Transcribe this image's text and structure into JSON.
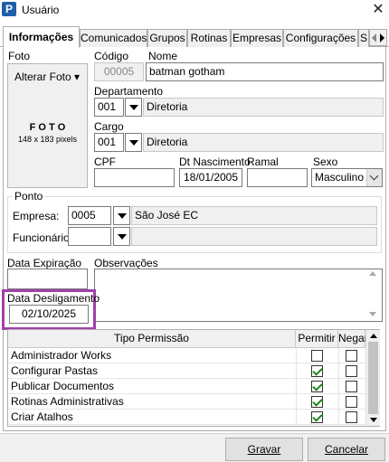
{
  "window": {
    "title": "Usuário",
    "app_icon": "P",
    "close": "✕"
  },
  "tabs": [
    {
      "label": "Informações"
    },
    {
      "label": "Comunicados"
    },
    {
      "label": "Grupos"
    },
    {
      "label": "Rotinas"
    },
    {
      "label": "Empresas"
    },
    {
      "label": "Configurações"
    },
    {
      "label": "S"
    }
  ],
  "foto": {
    "label": "Foto",
    "button": "Alterar Foto ▾",
    "placeholder_title": "F O T O",
    "placeholder_size": "148 x 183 pixels"
  },
  "codigo": {
    "label": "Código",
    "value": "00005"
  },
  "nome": {
    "label": "Nome",
    "value": "batman gotham"
  },
  "departamento": {
    "label": "Departamento",
    "code": "001",
    "name": "Diretoria"
  },
  "cargo": {
    "label": "Cargo",
    "code": "001",
    "name": "Diretoria"
  },
  "cpf": {
    "label": "CPF",
    "value": ""
  },
  "dt_nascimento": {
    "label": "Dt Nascimento",
    "value": "18/01/2005"
  },
  "ramal": {
    "label": "Ramal",
    "value": ""
  },
  "sexo": {
    "label": "Sexo",
    "value": "Masculino"
  },
  "ponto": {
    "label": "Ponto",
    "empresa": {
      "label": "Empresa:",
      "code": "0005",
      "name": "São José EC"
    },
    "funcionario": {
      "label": "Funcionário:",
      "code": "",
      "name": ""
    }
  },
  "data_expiracao": {
    "label": "Data Expiração",
    "value": ""
  },
  "observacoes": {
    "label": "Observações",
    "value": ""
  },
  "data_desligamento": {
    "label": "Data Desligamento",
    "value": "02/10/2025"
  },
  "permissoes": {
    "headers": {
      "tipo": "Tipo Permissão",
      "permitir": "Permitir",
      "negar": "Negar"
    },
    "rows": [
      {
        "name": "Administrador Works",
        "permitir": false,
        "negar": false
      },
      {
        "name": "Configurar Pastas",
        "permitir": true,
        "negar": false
      },
      {
        "name": "Publicar Documentos",
        "permitir": true,
        "negar": false
      },
      {
        "name": "Rotinas Administrativas",
        "permitir": true,
        "negar": false
      },
      {
        "name": "Criar Atalhos",
        "permitir": true,
        "negar": false
      }
    ]
  },
  "buttons": {
    "save": "Gravar",
    "cancel": "Cancelar"
  },
  "colors": {
    "highlight": "#a040a8",
    "check": "#1a8a1a",
    "app_icon": "#1e5fa8"
  }
}
